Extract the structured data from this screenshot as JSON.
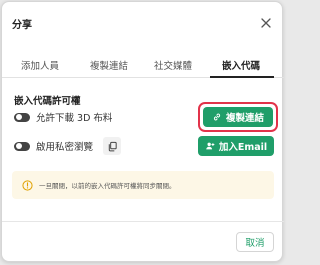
{
  "dialog": {
    "title": "分享",
    "close_icon": "close-icon"
  },
  "tabs": [
    {
      "label": "添加人員",
      "active": false
    },
    {
      "label": "複製連結",
      "active": false
    },
    {
      "label": "社交媒體",
      "active": false
    },
    {
      "label": "嵌入代碼",
      "active": true
    }
  ],
  "section": {
    "title": "嵌入代碼許可權"
  },
  "options": {
    "allow_download_label": "允許下載 3D 布料",
    "private_browse_label": "啟用私密瀏覽"
  },
  "buttons": {
    "copy_link_label": "複製連結",
    "add_email_label": "加入Email",
    "cancel_label": "取消"
  },
  "notice": {
    "text": "一旦關閉，以前的嵌入代碼許可權將同步關閉。"
  },
  "colors": {
    "accent_green": "#1f9e69",
    "highlight_red": "#e2334a",
    "notice_bg": "#fdf7e6",
    "notice_icon": "#e0a100"
  }
}
